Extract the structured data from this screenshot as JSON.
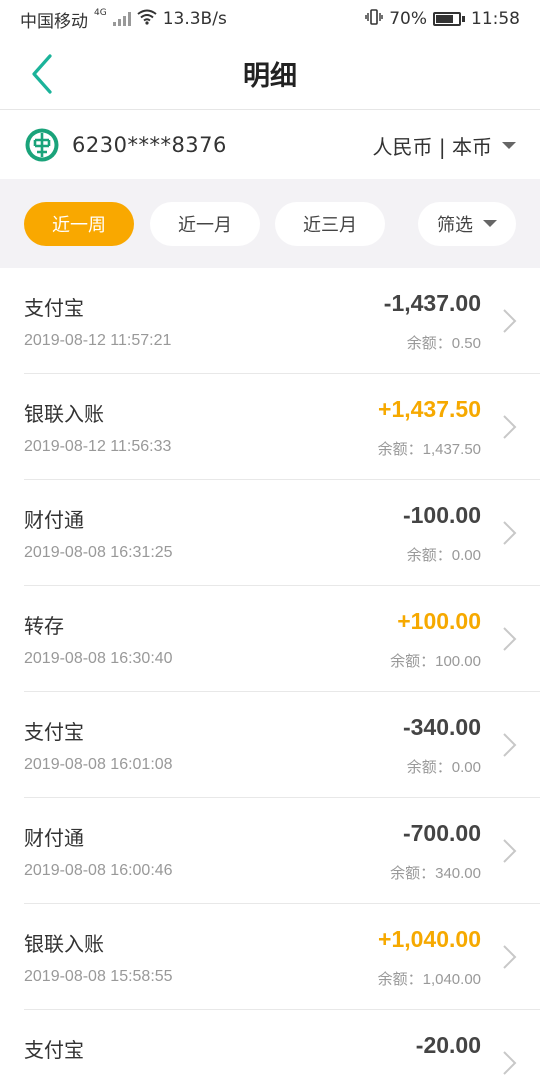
{
  "status_bar": {
    "carrier": "中国移动",
    "network": "4G",
    "speed": "13.3B/s",
    "battery": "70%",
    "time": "11:58"
  },
  "nav": {
    "title": "明细"
  },
  "account": {
    "card_number": "6230****8376",
    "currency": "人民币 | 本币"
  },
  "filters": {
    "week": "近一周",
    "month": "近一月",
    "three_months": "近三月",
    "filter": "筛选"
  },
  "colors": {
    "accent": "#f9a800",
    "positive": "#f6a900",
    "brand": "#1aa37a"
  },
  "transactions": [
    {
      "name": "支付宝",
      "date": "2019-08-12 11:57:21",
      "amount": "-1,437.00",
      "balance": "余额：0.50"
    },
    {
      "name": "银联入账",
      "date": "2019-08-12 11:56:33",
      "amount": "+1,437.50",
      "balance": "余额：1,437.50"
    },
    {
      "name": "财付通",
      "date": "2019-08-08 16:31:25",
      "amount": "-100.00",
      "balance": "余额：0.00"
    },
    {
      "name": "转存",
      "date": "2019-08-08 16:30:40",
      "amount": "+100.00",
      "balance": "余额：100.00"
    },
    {
      "name": "支付宝",
      "date": "2019-08-08 16:01:08",
      "amount": "-340.00",
      "balance": "余额：0.00"
    },
    {
      "name": "财付通",
      "date": "2019-08-08 16:00:46",
      "amount": "-700.00",
      "balance": "余额：340.00"
    },
    {
      "name": "银联入账",
      "date": "2019-08-08 15:58:55",
      "amount": "+1,040.00",
      "balance": "余额：1,040.00"
    },
    {
      "name": "支付宝",
      "date": "",
      "amount": "-20.00",
      "balance": ""
    }
  ]
}
